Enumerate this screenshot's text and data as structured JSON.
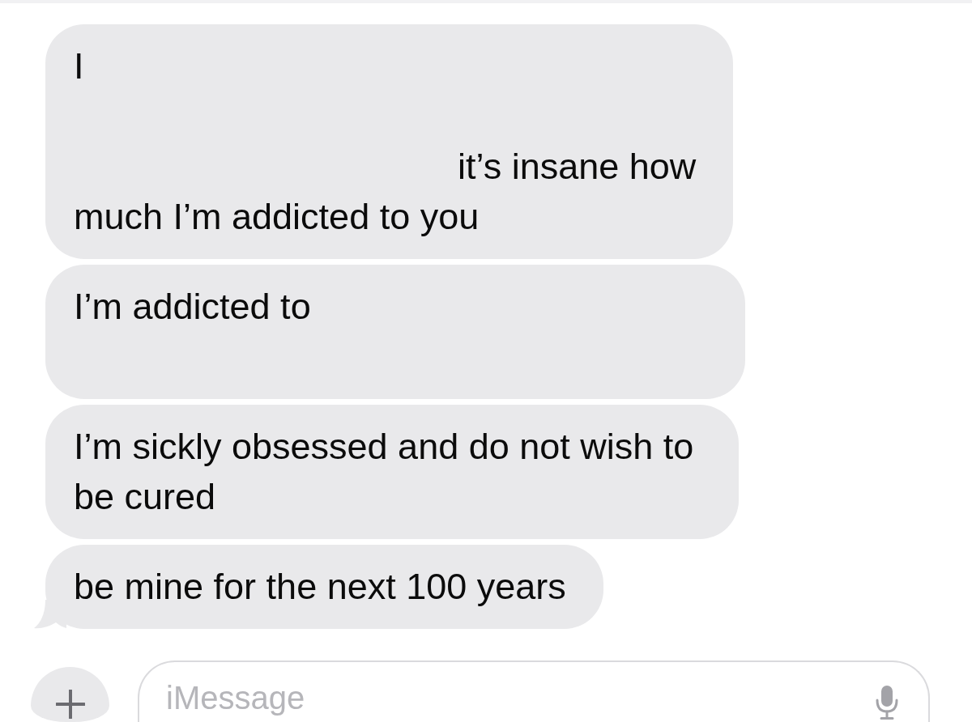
{
  "messages": [
    {
      "parts": [
        "I",
        "it’s insane how much I’m addicted to you"
      ],
      "tail": false
    },
    {
      "parts": [
        "I’m addicted to"
      ],
      "tail": false
    },
    {
      "parts": [
        "I’m sickly obsessed and do not wish to be cured"
      ],
      "tail": false
    },
    {
      "parts": [
        "be mine for the next 100 years"
      ],
      "tail": true
    }
  ],
  "composer": {
    "placeholder": "iMessage"
  }
}
